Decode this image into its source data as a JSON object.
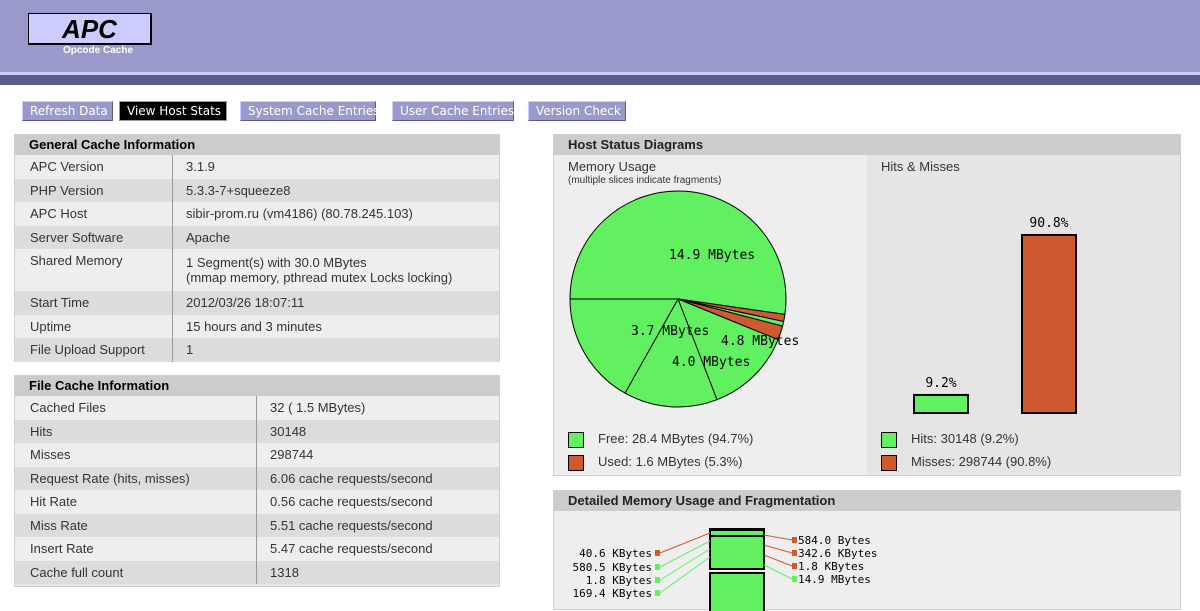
{
  "header": {
    "logo_title": "APC",
    "logo_subtitle": "Opcode Cache"
  },
  "nav": [
    {
      "label": "Refresh Data",
      "active": false
    },
    {
      "label": "View Host Stats",
      "active": true
    },
    {
      "label": "System Cache Entries",
      "active": false
    },
    {
      "label": "User Cache Entries",
      "active": false
    },
    {
      "label": "Version Check",
      "active": false
    }
  ],
  "general_cache": {
    "title": "General Cache Information",
    "rows": [
      {
        "key": "APC Version",
        "value": "3.1.9"
      },
      {
        "key": "PHP Version",
        "value": "5.3.3-7+squeeze8"
      },
      {
        "key": "APC Host",
        "value": "sibir-prom.ru (vm4186) (80.78.245.103)"
      },
      {
        "key": "Server Software",
        "value": "Apache"
      },
      {
        "key": "Shared Memory",
        "value": "1 Segment(s) with 30.0 MBytes",
        "value2": "(mmap memory, pthread mutex Locks locking)"
      },
      {
        "key": "Start Time",
        "value": "2012/03/26 18:07:11"
      },
      {
        "key": "Uptime",
        "value": "15 hours and 3 minutes"
      },
      {
        "key": "File Upload Support",
        "value": "1"
      }
    ]
  },
  "file_cache": {
    "title": "File Cache Information",
    "rows": [
      {
        "key": "Cached Files",
        "value": "32 ( 1.5 MBytes)"
      },
      {
        "key": "Hits",
        "value": "30148"
      },
      {
        "key": "Misses",
        "value": "298744"
      },
      {
        "key": "Request Rate (hits, misses)",
        "value": "6.06 cache requests/second"
      },
      {
        "key": "Hit Rate",
        "value": "0.56 cache requests/second"
      },
      {
        "key": "Miss Rate",
        "value": "5.51 cache requests/second"
      },
      {
        "key": "Insert Rate",
        "value": "5.47 cache requests/second"
      },
      {
        "key": "Cache full count",
        "value": "1318"
      }
    ]
  },
  "host_status": {
    "title": "Host Status Diagrams",
    "memory_label": "Memory Usage",
    "memory_sub": "(multiple slices indicate fragments)",
    "hits_label": "Hits & Misses",
    "pie_labels": [
      "14.9 MBytes",
      "3.7 MBytes",
      "4.8 MBytes",
      "4.0 MBytes"
    ],
    "legend_free": "Free: 28.4 MBytes (94.7%)",
    "legend_used": "Used: 1.6 MBytes (5.3%)",
    "legend_hits": "Hits: 30148 (9.2%)",
    "legend_misses": "Misses: 298744 (90.8%)",
    "colors": {
      "free": "#60f060",
      "used": "#d05a30"
    }
  },
  "chart_data": [
    {
      "type": "pie",
      "categories": [
        "free",
        "used",
        "free",
        "used",
        "free",
        "free",
        "free"
      ],
      "values": [
        14.9,
        0.3,
        0.2,
        0.6,
        3.7,
        4.0,
        4.8
      ],
      "labels": [
        "14.9 MBytes",
        "",
        "",
        "",
        "3.7 MBytes",
        "4.0 MBytes",
        "4.8 MBytes"
      ]
    },
    {
      "type": "bar",
      "categories": [
        "Hits",
        "Misses"
      ],
      "values": [
        9.2,
        90.8
      ],
      "data_labels": [
        "9.2%",
        "90.8%"
      ],
      "ylim": [
        0,
        100
      ]
    }
  ],
  "detailed_memory": {
    "title": "Detailed Memory Usage and Fragmentation",
    "left_labels": [
      "40.6 KBytes",
      "580.5 KBytes",
      "1.8 KBytes",
      "169.4 KBytes"
    ],
    "right_labels": [
      "584.0 Bytes",
      "342.6 KBytes",
      "1.8 KBytes",
      "14.9 MBytes"
    ]
  }
}
